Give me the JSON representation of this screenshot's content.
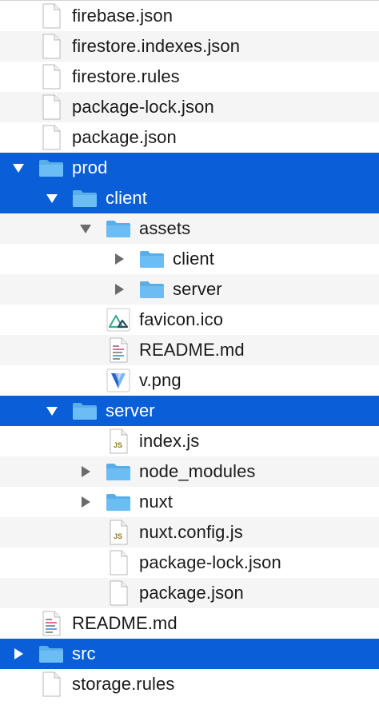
{
  "colors": {
    "selection": "#0a5fd9",
    "folder": "#6bbdf4",
    "folder_tab": "#5aaee8",
    "stripe": "#f5f5f5",
    "text": "#1a1a1a"
  },
  "rows": [
    {
      "label": "firebase.json",
      "icon": "document-icon",
      "depth": 0,
      "kind": "file"
    },
    {
      "label": "firestore.indexes.json",
      "icon": "document-icon",
      "depth": 0,
      "kind": "file"
    },
    {
      "label": "firestore.rules",
      "icon": "document-icon",
      "depth": 0,
      "kind": "file"
    },
    {
      "label": "package-lock.json",
      "icon": "document-icon",
      "depth": 0,
      "kind": "file"
    },
    {
      "label": "package.json",
      "icon": "document-icon",
      "depth": 0,
      "kind": "file"
    },
    {
      "label": "prod",
      "icon": "folder-icon",
      "depth": 0,
      "kind": "folder",
      "expanded": true,
      "selected": true
    },
    {
      "label": "client",
      "icon": "folder-icon",
      "depth": 1,
      "kind": "folder",
      "expanded": true,
      "selected": true
    },
    {
      "label": "assets",
      "icon": "folder-icon",
      "depth": 2,
      "kind": "folder",
      "expanded": true
    },
    {
      "label": "client",
      "icon": "folder-icon",
      "depth": 3,
      "kind": "folder",
      "expanded": false
    },
    {
      "label": "server",
      "icon": "folder-icon",
      "depth": 3,
      "kind": "folder",
      "expanded": false
    },
    {
      "label": "favicon.ico",
      "icon": "nuxt-icon",
      "depth": 2,
      "kind": "file"
    },
    {
      "label": "README.md",
      "icon": "markdown-icon",
      "depth": 2,
      "kind": "file"
    },
    {
      "label": "v.png",
      "icon": "vuetify-icon",
      "depth": 2,
      "kind": "file"
    },
    {
      "label": "server",
      "icon": "folder-icon",
      "depth": 1,
      "kind": "folder",
      "expanded": true,
      "selected": true
    },
    {
      "label": "index.js",
      "icon": "js-file-icon",
      "depth": 2,
      "kind": "file",
      "badge": "JS"
    },
    {
      "label": "node_modules",
      "icon": "folder-icon",
      "depth": 2,
      "kind": "folder",
      "expanded": false
    },
    {
      "label": "nuxt",
      "icon": "folder-icon",
      "depth": 2,
      "kind": "folder",
      "expanded": false
    },
    {
      "label": "nuxt.config.js",
      "icon": "js-file-icon",
      "depth": 2,
      "kind": "file",
      "badge": "JS"
    },
    {
      "label": "package-lock.json",
      "icon": "document-icon",
      "depth": 2,
      "kind": "file"
    },
    {
      "label": "package.json",
      "icon": "document-icon",
      "depth": 2,
      "kind": "file"
    },
    {
      "label": "README.md",
      "icon": "markdown-icon",
      "depth": 0,
      "kind": "file"
    },
    {
      "label": "src",
      "icon": "folder-icon",
      "depth": 0,
      "kind": "folder",
      "expanded": false,
      "selected": true
    },
    {
      "label": "storage.rules",
      "icon": "document-icon",
      "depth": 0,
      "kind": "file"
    }
  ]
}
